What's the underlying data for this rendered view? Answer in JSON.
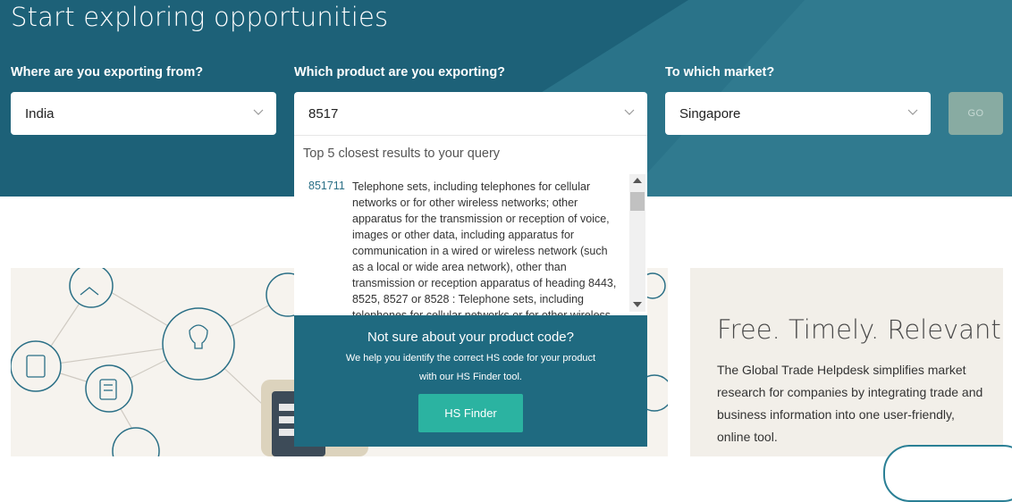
{
  "hero": {
    "title": "Start exploring opportunities"
  },
  "form": {
    "origin": {
      "label": "Where are you exporting from?",
      "value": "India"
    },
    "product": {
      "label": "Which product are you exporting?",
      "value": "8517"
    },
    "market": {
      "label": "To which market?",
      "value": "Singapore"
    },
    "go_label": "GO"
  },
  "dropdown": {
    "heading": "Top 5 closest results to your query",
    "results": [
      {
        "code": "851711",
        "description": "Telephone sets, including telephones for cellular networks or for other wireless networks; other apparatus for the transmission or reception of voice, images or other data, including apparatus for communication in a wired or wireless network (such as a local or wide area network), other than transmission or reception apparatus of heading 8443, 8525, 8527 or 8528 : Telephone sets, including telephones for cellular networks or for other wireless networks"
      }
    ]
  },
  "helper": {
    "title": "Not sure about your product code?",
    "text": "We help you identify the correct HS code for your product with our HS Finder tool.",
    "button_label": "HS Finder"
  },
  "info": {
    "heading": "Free. Timely. Relevant.",
    "body": "The Global Trade Helpdesk simplifies market research for companies by integrating trade and business information into one user-friendly, online tool."
  },
  "colors": {
    "hero_bg": "#1d6178",
    "hero_light": "#2f7a8f",
    "go_disabled": "#88aba2",
    "hs_button": "#2bb3a1",
    "helper_bg": "#1f6a80",
    "code_link": "#2a6f86"
  },
  "icons": {
    "chevron": "chevron-down-icon",
    "scroll_up": "scroll-up-arrow-icon",
    "scroll_down": "scroll-down-arrow-icon"
  }
}
